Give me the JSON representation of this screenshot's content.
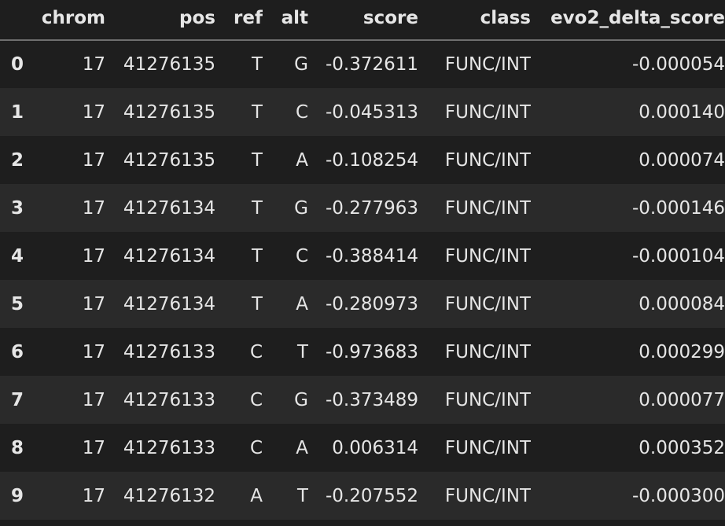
{
  "table": {
    "columns": [
      {
        "key": "index",
        "label": ""
      },
      {
        "key": "chrom",
        "label": "chrom"
      },
      {
        "key": "pos",
        "label": "pos"
      },
      {
        "key": "ref",
        "label": "ref"
      },
      {
        "key": "alt",
        "label": "alt"
      },
      {
        "key": "score",
        "label": "score"
      },
      {
        "key": "class",
        "label": "class"
      },
      {
        "key": "evo2_delta_score",
        "label": "evo2_delta_score"
      }
    ],
    "rows": [
      {
        "index": "0",
        "chrom": "17",
        "pos": "41276135",
        "ref": "T",
        "alt": "G",
        "score": "-0.372611",
        "class": "FUNC/INT",
        "evo2_delta_score": "-0.000054"
      },
      {
        "index": "1",
        "chrom": "17",
        "pos": "41276135",
        "ref": "T",
        "alt": "C",
        "score": "-0.045313",
        "class": "FUNC/INT",
        "evo2_delta_score": "0.000140"
      },
      {
        "index": "2",
        "chrom": "17",
        "pos": "41276135",
        "ref": "T",
        "alt": "A",
        "score": "-0.108254",
        "class": "FUNC/INT",
        "evo2_delta_score": "0.000074"
      },
      {
        "index": "3",
        "chrom": "17",
        "pos": "41276134",
        "ref": "T",
        "alt": "G",
        "score": "-0.277963",
        "class": "FUNC/INT",
        "evo2_delta_score": "-0.000146"
      },
      {
        "index": "4",
        "chrom": "17",
        "pos": "41276134",
        "ref": "T",
        "alt": "C",
        "score": "-0.388414",
        "class": "FUNC/INT",
        "evo2_delta_score": "-0.000104"
      },
      {
        "index": "5",
        "chrom": "17",
        "pos": "41276134",
        "ref": "T",
        "alt": "A",
        "score": "-0.280973",
        "class": "FUNC/INT",
        "evo2_delta_score": "0.000084"
      },
      {
        "index": "6",
        "chrom": "17",
        "pos": "41276133",
        "ref": "C",
        "alt": "T",
        "score": "-0.973683",
        "class": "FUNC/INT",
        "evo2_delta_score": "0.000299"
      },
      {
        "index": "7",
        "chrom": "17",
        "pos": "41276133",
        "ref": "C",
        "alt": "G",
        "score": "-0.373489",
        "class": "FUNC/INT",
        "evo2_delta_score": "0.000077"
      },
      {
        "index": "8",
        "chrom": "17",
        "pos": "41276133",
        "ref": "C",
        "alt": "A",
        "score": "0.006314",
        "class": "FUNC/INT",
        "evo2_delta_score": "0.000352"
      },
      {
        "index": "9",
        "chrom": "17",
        "pos": "41276132",
        "ref": "A",
        "alt": "T",
        "score": "-0.207552",
        "class": "FUNC/INT",
        "evo2_delta_score": "-0.000300"
      }
    ]
  }
}
